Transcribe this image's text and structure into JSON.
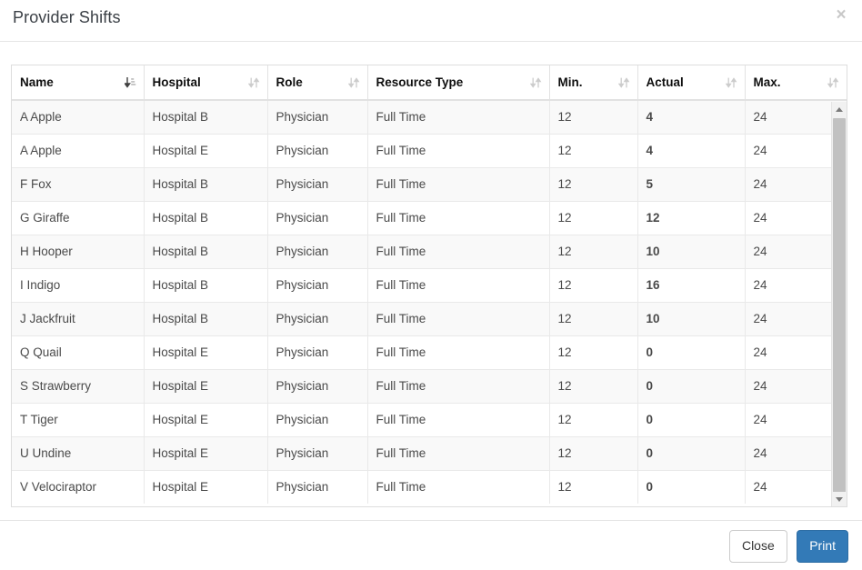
{
  "modal": {
    "title": "Provider Shifts",
    "close_icon": "close-icon",
    "close_symbol": "×"
  },
  "table": {
    "columns": [
      {
        "label": "Name",
        "key": "name",
        "sort_state": "asc",
        "sort_icon": "sort-ascending-icon"
      },
      {
        "label": "Hospital",
        "key": "hospital",
        "sort_state": "none",
        "sort_icon": "sort-none-icon"
      },
      {
        "label": "Role",
        "key": "role",
        "sort_state": "none",
        "sort_icon": "sort-none-icon"
      },
      {
        "label": "Resource Type",
        "key": "restype",
        "sort_state": "none",
        "sort_icon": "sort-none-icon"
      },
      {
        "label": "Min.",
        "key": "min",
        "sort_state": "none",
        "sort_icon": "sort-none-icon"
      },
      {
        "label": "Actual",
        "key": "actual",
        "sort_state": "none",
        "sort_icon": "sort-none-icon"
      },
      {
        "label": "Max.",
        "key": "max",
        "sort_state": "none",
        "sort_icon": "sort-none-icon"
      }
    ],
    "rows": [
      {
        "name": "A Apple",
        "hospital": "Hospital B",
        "role": "Physician",
        "restype": "Full Time",
        "min": "12",
        "actual": "4",
        "actual_status": "low"
      },
      {
        "name": "A Apple",
        "hospital": "Hospital E",
        "role": "Physician",
        "restype": "Full Time",
        "min": "12",
        "actual": "4",
        "actual_status": "low"
      },
      {
        "name": "F Fox",
        "hospital": "Hospital B",
        "role": "Physician",
        "restype": "Full Time",
        "min": "12",
        "actual": "5",
        "actual_status": "low"
      },
      {
        "name": "G Giraffe",
        "hospital": "Hospital B",
        "role": "Physician",
        "restype": "Full Time",
        "min": "12",
        "actual": "12",
        "actual_status": "ok"
      },
      {
        "name": "H Hooper",
        "hospital": "Hospital B",
        "role": "Physician",
        "restype": "Full Time",
        "min": "12",
        "actual": "10",
        "actual_status": "low"
      },
      {
        "name": "I Indigo",
        "hospital": "Hospital B",
        "role": "Physician",
        "restype": "Full Time",
        "min": "12",
        "actual": "16",
        "actual_status": "ok"
      },
      {
        "name": "J Jackfruit",
        "hospital": "Hospital B",
        "role": "Physician",
        "restype": "Full Time",
        "min": "12",
        "actual": "10",
        "actual_status": "low"
      },
      {
        "name": "Q Quail",
        "hospital": "Hospital E",
        "role": "Physician",
        "restype": "Full Time",
        "min": "12",
        "actual": "0",
        "actual_status": "low"
      },
      {
        "name": "S Strawberry",
        "hospital": "Hospital E",
        "role": "Physician",
        "restype": "Full Time",
        "min": "12",
        "actual": "0",
        "actual_status": "low"
      },
      {
        "name": "T Tiger",
        "hospital": "Hospital E",
        "role": "Physician",
        "restype": "Full Time",
        "min": "12",
        "actual": "0",
        "actual_status": "low"
      },
      {
        "name": "U Undine",
        "hospital": "Hospital E",
        "role": "Physician",
        "restype": "Full Time",
        "min": "12",
        "actual": "0",
        "actual_status": "low"
      },
      {
        "name": "V Velociraptor",
        "hospital": "Hospital E",
        "role": "Physician",
        "restype": "Full Time",
        "min": "12",
        "actual": "0",
        "actual_status": "low"
      }
    ],
    "max_value_all_rows": "24"
  },
  "scrollbar": {
    "up_icon": "scroll-up-arrow-icon",
    "down_icon": "scroll-down-arrow-icon",
    "orientation": "vertical"
  },
  "footer": {
    "close_label": "Close",
    "print_label": "Print"
  },
  "colors": {
    "primary": "#337ab7",
    "value_low": "#ff0000",
    "value_ok": "#008000",
    "title": "#3b4046",
    "border": "#dddddd"
  }
}
